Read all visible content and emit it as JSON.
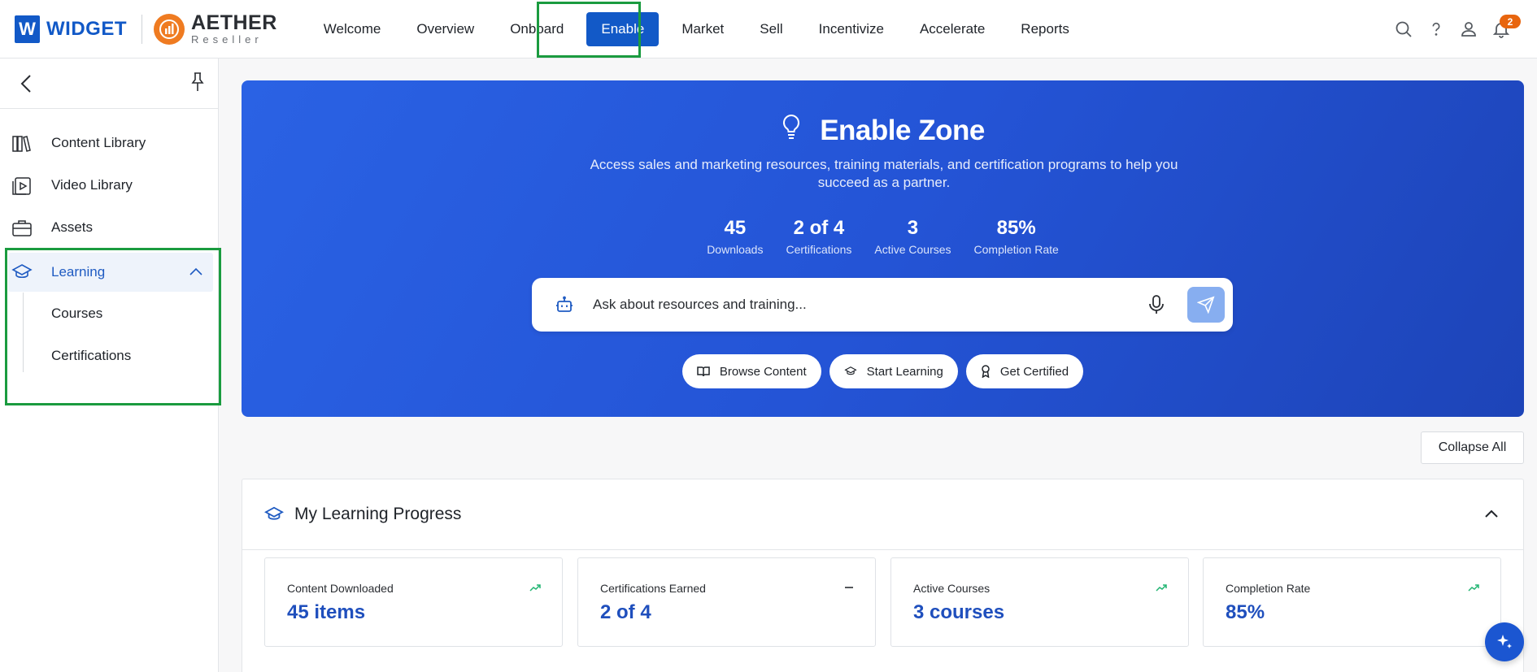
{
  "brand": {
    "widget_letter": "W",
    "widget_text": "WIDGET",
    "aether_main": "AETHER",
    "aether_sub": "Reseller"
  },
  "nav": {
    "items": [
      {
        "label": "Welcome"
      },
      {
        "label": "Overview"
      },
      {
        "label": "Onboard"
      },
      {
        "label": "Enable",
        "active": true
      },
      {
        "label": "Market"
      },
      {
        "label": "Sell"
      },
      {
        "label": "Incentivize"
      },
      {
        "label": "Accelerate"
      },
      {
        "label": "Reports"
      }
    ],
    "notification_count": "2"
  },
  "sidebar": {
    "items": [
      {
        "label": "Content Library",
        "icon": "books-icon"
      },
      {
        "label": "Video Library",
        "icon": "video-icon"
      },
      {
        "label": "Assets",
        "icon": "briefcase-icon"
      },
      {
        "label": "Learning",
        "icon": "graduation-cap-icon",
        "expanded": true
      }
    ],
    "learning_sub": [
      {
        "label": "Courses"
      },
      {
        "label": "Certifications"
      }
    ]
  },
  "hero": {
    "title": "Enable Zone",
    "description": "Access sales and marketing resources, training materials, and certification programs to help you succeed as a partner.",
    "stats": [
      {
        "value": "45",
        "label": "Downloads"
      },
      {
        "value": "2 of 4",
        "label": "Certifications"
      },
      {
        "value": "3",
        "label": "Active Courses"
      },
      {
        "value": "85%",
        "label": "Completion Rate"
      }
    ],
    "chat_placeholder": "Ask about resources and training...",
    "chips": [
      {
        "label": "Browse Content",
        "icon": "book-open-icon"
      },
      {
        "label": "Start Learning",
        "icon": "graduation-cap-icon"
      },
      {
        "label": "Get Certified",
        "icon": "award-icon"
      }
    ]
  },
  "collapse_all": "Collapse All",
  "progress": {
    "title": "My Learning Progress",
    "cards": [
      {
        "label": "Content Downloaded",
        "value": "45 items",
        "trend": "up"
      },
      {
        "label": "Certifications Earned",
        "value": "2 of 4",
        "trend": "flat"
      },
      {
        "label": "Active Courses",
        "value": "3 courses",
        "trend": "up"
      },
      {
        "label": "Completion Rate",
        "value": "85%",
        "trend": "up"
      }
    ]
  },
  "colors": {
    "primary": "#1259c7",
    "accent_orange": "#ef7b21",
    "highlight_green": "#1a9b3f",
    "trend_green": "#22b573"
  }
}
